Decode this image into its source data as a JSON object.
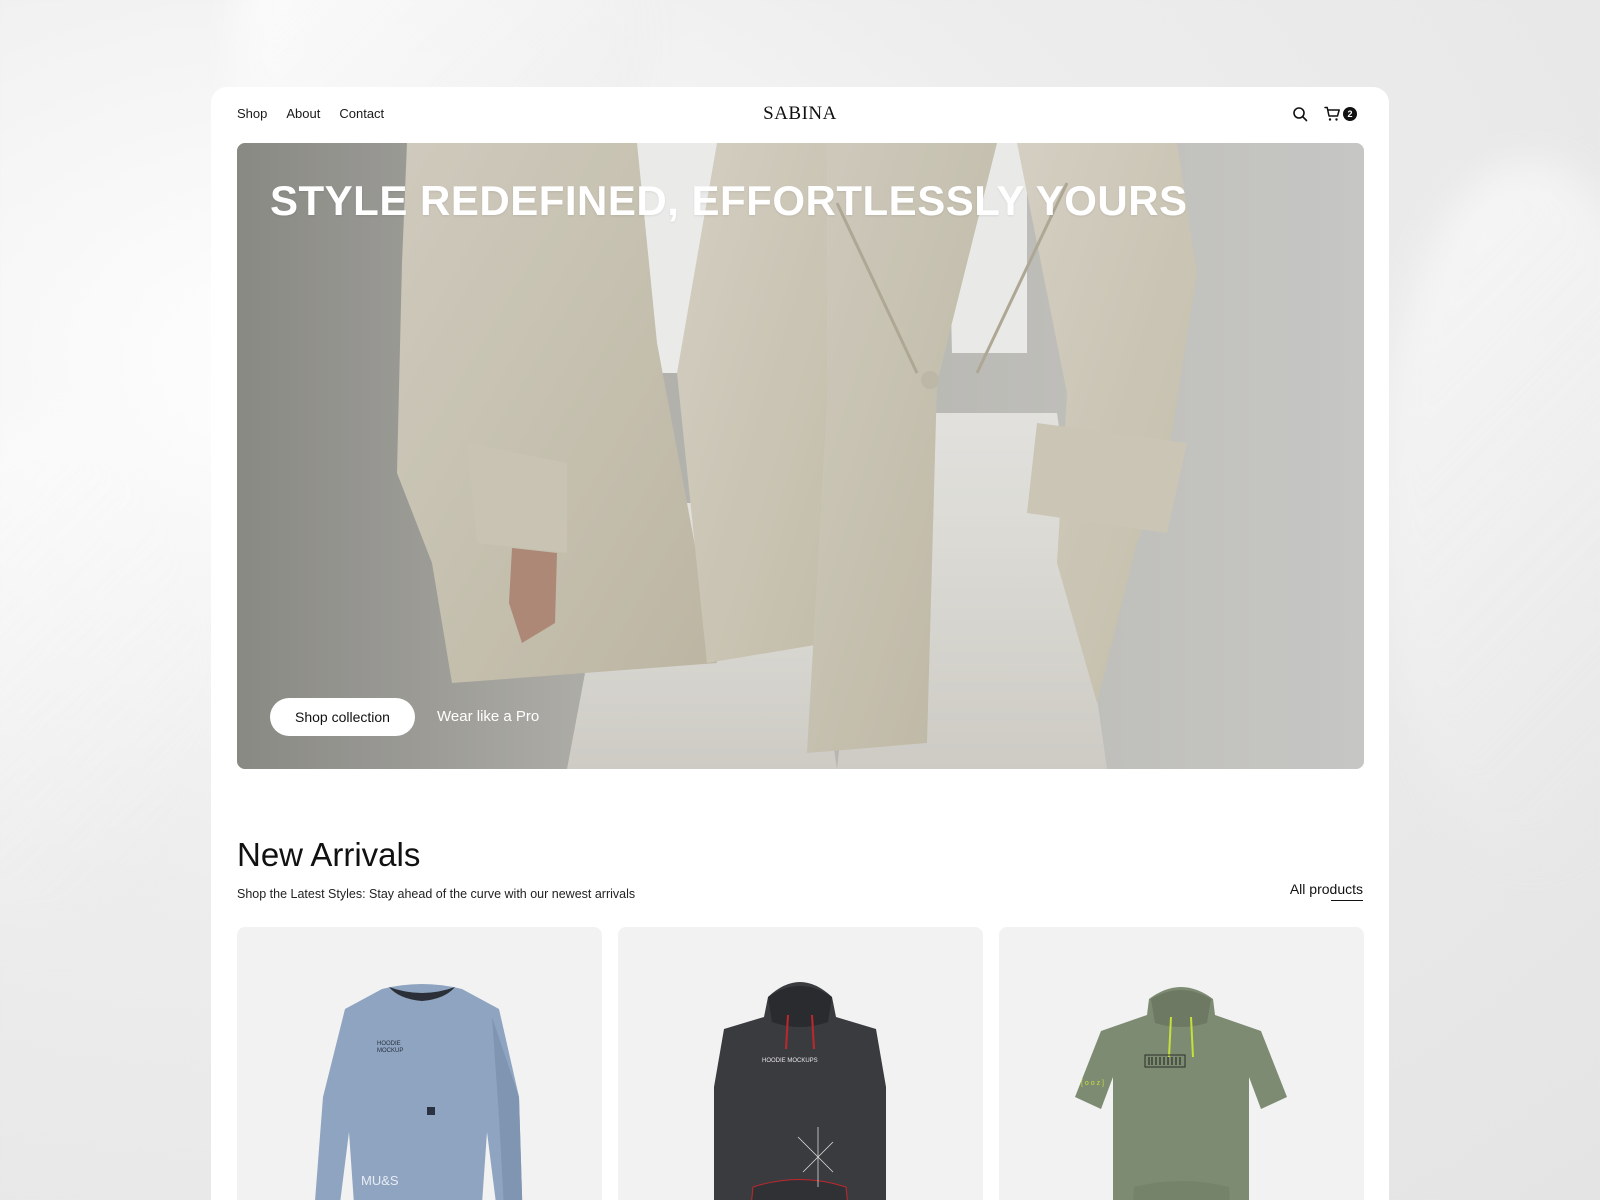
{
  "brand": {
    "logo": "SABINA"
  },
  "nav": {
    "items": [
      "Shop",
      "About",
      "Contact"
    ]
  },
  "header": {
    "cart_count": "2"
  },
  "hero": {
    "title": "STYLE REDEFINED, EFFORTLESSLY YOURS",
    "cta_label": "Shop collection",
    "secondary_link": "Wear like a Pro"
  },
  "new_arrivals": {
    "title": "New Arrivals",
    "subtitle": "Shop the Latest Styles: Stay ahead of the curve with our newest arrivals",
    "all_products_label": "All products"
  },
  "products": [
    {
      "garment": "sweatshirt",
      "color": "#8ea4c0",
      "print": "HOODIE MOCKUP",
      "sleeve_text": "MU&S"
    },
    {
      "garment": "hoodie",
      "color": "#3a3b3f",
      "print": "HOODIE MOCKUPS",
      "accent": "#c0272d"
    },
    {
      "garment": "short-sleeve-hoodie",
      "color": "#7e8b73",
      "accent": "#c6e03a"
    }
  ],
  "colors": {
    "page_bg": "#ffffff",
    "text": "#111111",
    "card_bg": "#f2f2f2"
  }
}
